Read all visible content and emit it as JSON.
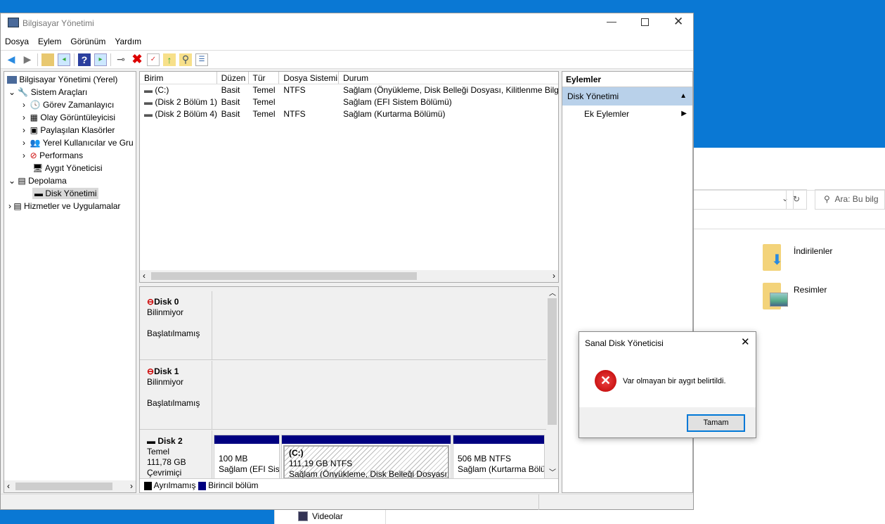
{
  "window": {
    "title": "Bilgisayar Yönetimi"
  },
  "menu": [
    "Dosya",
    "Eylem",
    "Görünüm",
    "Yardım"
  ],
  "tree": {
    "root": "Bilgisayar Yönetimi (Yerel)",
    "system_tools": "Sistem Araçları",
    "items": [
      "Görev Zamanlayıcı",
      "Olay Görüntüleyicisi",
      "Paylaşılan Klasörler",
      "Yerel Kullanıcılar ve Gru",
      "Performans",
      "Aygıt Yöneticisi"
    ],
    "storage": "Depolama",
    "disk_mgmt": "Disk Yönetimi",
    "services": "Hizmetler ve Uygulamalar"
  },
  "volumes": {
    "columns": [
      "Birim",
      "Düzen",
      "Tür",
      "Dosya Sistemi",
      "Durum"
    ],
    "rows": [
      [
        "(C:)",
        "Basit",
        "Temel",
        "NTFS",
        "Sağlam (Önyükleme, Disk Belleği Dosyası, Kilitlenme Bilgisi"
      ],
      [
        "(Disk 2 Bölüm 1)",
        "Basit",
        "Temel",
        "",
        "Sağlam (EFI Sistem Bölümü)"
      ],
      [
        "(Disk 2 Bölüm 4)",
        "Basit",
        "Temel",
        "NTFS",
        "Sağlam (Kurtarma Bölümü)"
      ]
    ]
  },
  "disks": [
    {
      "name": "Disk 0",
      "type": "Bilinmiyor",
      "status": "Başlatılmamış"
    },
    {
      "name": "Disk 1",
      "type": "Bilinmiyor",
      "status": "Başlatılmamış"
    },
    {
      "name": "Disk 2",
      "type": "Temel",
      "size": "111,78 GB",
      "status": "Çevrimiçi",
      "partitions": [
        {
          "label": "",
          "size": "100 MB",
          "status": "Sağlam (EFI Sistem Bölümü)"
        },
        {
          "label": "(C:)",
          "size": "111,19 GB NTFS",
          "status": "Sağlam (Önyükleme, Disk Belleği Dosyası, Kilitlenme Bilgisi)"
        },
        {
          "label": "",
          "size": "506 MB NTFS",
          "status": "Sağlam (Kurtarma Bölümü)"
        }
      ]
    }
  ],
  "legend": [
    "Ayrılmamış",
    "Birincil bölüm"
  ],
  "actions": {
    "title": "Eylemler",
    "section": "Disk Yönetimi",
    "more": "Ek Eylemler"
  },
  "dialog": {
    "title": "Sanal Disk Yöneticisi",
    "message": "Var olmayan bir aygıt belirtildi.",
    "ok": "Tamam"
  },
  "explorer": {
    "search_placeholder": "Ara: Bu bilg",
    "folders": [
      "İndirilenler",
      "Resimler",
      "Videolar"
    ]
  },
  "colors": {
    "primary_partition": "#000080",
    "unallocated": "#000000",
    "selection": "#cce8ff"
  }
}
